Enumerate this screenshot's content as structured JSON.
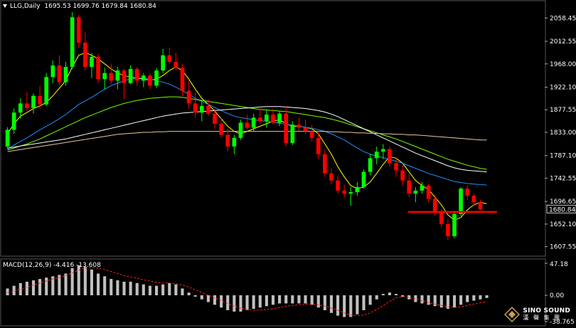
{
  "header": {
    "symbol": "LLG,Daily",
    "ohlc": "1695.53 1699.76 1679.84 1680.84"
  },
  "macd_header": "MACD(12,26,9) -4.416 -13.608",
  "last_price_label": "1680.84",
  "colors": {
    "background": "#000000",
    "bull": "#00ff00",
    "bear": "#ff0000",
    "fast_ma": "#ffff00",
    "blue_ma": "#1e90ff",
    "green_ma": "#7cfc00",
    "white_ma": "#ffffff",
    "tan_ma": "#e6c89a",
    "macd_hist": "#c0c0c0",
    "macd_signal": "#ff2020",
    "support": "#ff0000",
    "grid": "#333333"
  },
  "logo": {
    "line1": "SINO SOUND",
    "line2": "漢 聲 集 團",
    "icon": "diamond-logo-icon"
  },
  "chart_data": [
    {
      "type": "candlestick",
      "ylim": [
        1600,
        2080
      ],
      "yticks": [
        2058.45,
        2012.55,
        1968.0,
        1922.1,
        1877.55,
        1833.0,
        1787.1,
        1742.55,
        1696.65,
        1652.1,
        1607.55
      ],
      "support_level": 1676,
      "candles": [
        [
          1805,
          1843,
          1801,
          1838
        ],
        [
          1838,
          1880,
          1830,
          1872
        ],
        [
          1872,
          1900,
          1860,
          1890
        ],
        [
          1890,
          1912,
          1875,
          1881
        ],
        [
          1881,
          1910,
          1870,
          1905
        ],
        [
          1905,
          1925,
          1880,
          1888
        ],
        [
          1888,
          1950,
          1885,
          1942
        ],
        [
          1942,
          1975,
          1930,
          1965
        ],
        [
          1965,
          1985,
          1925,
          1932
        ],
        [
          1932,
          1972,
          1925,
          1962
        ],
        [
          1962,
          2070,
          1958,
          2060
        ],
        [
          2060,
          2065,
          2000,
          2010
        ],
        [
          2010,
          2030,
          1955,
          1962
        ],
        [
          1962,
          1990,
          1940,
          1982
        ],
        [
          1982,
          1988,
          1930,
          1938
        ],
        [
          1938,
          1960,
          1918,
          1950
        ],
        [
          1950,
          1968,
          1928,
          1935
        ],
        [
          1935,
          1962,
          1918,
          1955
        ],
        [
          1955,
          1958,
          1898,
          1930
        ],
        [
          1930,
          1965,
          1928,
          1958
        ],
        [
          1958,
          1962,
          1925,
          1935
        ],
        [
          1935,
          1950,
          1922,
          1945
        ],
        [
          1945,
          1950,
          1918,
          1925
        ],
        [
          1925,
          1960,
          1920,
          1955
        ],
        [
          1955,
          1998,
          1950,
          1985
        ],
        [
          1985,
          2000,
          1968,
          1972
        ],
        [
          1972,
          1990,
          1955,
          1960
        ],
        [
          1960,
          1968,
          1905,
          1915
        ],
        [
          1915,
          1935,
          1880,
          1890
        ],
        [
          1890,
          1912,
          1862,
          1872
        ],
        [
          1872,
          1895,
          1855,
          1885
        ],
        [
          1885,
          1898,
          1865,
          1870
        ],
        [
          1870,
          1880,
          1840,
          1850
        ],
        [
          1850,
          1862,
          1822,
          1828
        ],
        [
          1828,
          1840,
          1795,
          1805
        ],
        [
          1805,
          1828,
          1790,
          1822
        ],
        [
          1822,
          1858,
          1818,
          1852
        ],
        [
          1852,
          1868,
          1838,
          1842
        ],
        [
          1842,
          1870,
          1835,
          1862
        ],
        [
          1862,
          1880,
          1850,
          1855
        ],
        [
          1855,
          1878,
          1842,
          1868
        ],
        [
          1868,
          1880,
          1848,
          1852
        ],
        [
          1852,
          1875,
          1845,
          1870
        ],
        [
          1870,
          1885,
          1805,
          1812
        ],
        [
          1812,
          1855,
          1808,
          1848
        ],
        [
          1848,
          1862,
          1835,
          1842
        ],
        [
          1842,
          1858,
          1830,
          1835
        ],
        [
          1835,
          1848,
          1815,
          1822
        ],
        [
          1822,
          1835,
          1780,
          1790
        ],
        [
          1790,
          1800,
          1745,
          1752
        ],
        [
          1752,
          1762,
          1730,
          1738
        ],
        [
          1738,
          1748,
          1712,
          1718
        ],
        [
          1718,
          1730,
          1705,
          1712
        ],
        [
          1712,
          1725,
          1688,
          1715
        ],
        [
          1715,
          1735,
          1708,
          1725
        ],
        [
          1725,
          1760,
          1722,
          1755
        ],
        [
          1755,
          1790,
          1748,
          1782
        ],
        [
          1782,
          1805,
          1770,
          1795
        ],
        [
          1795,
          1810,
          1780,
          1800
        ],
        [
          1800,
          1805,
          1765,
          1772
        ],
        [
          1772,
          1782,
          1745,
          1758
        ],
        [
          1758,
          1768,
          1728,
          1738
        ],
        [
          1738,
          1750,
          1705,
          1712
        ],
        [
          1712,
          1725,
          1695,
          1718
        ],
        [
          1718,
          1735,
          1712,
          1728
        ],
        [
          1728,
          1732,
          1695,
          1702
        ],
        [
          1702,
          1710,
          1668,
          1675
        ],
        [
          1675,
          1682,
          1645,
          1652
        ],
        [
          1652,
          1662,
          1620,
          1628
        ],
        [
          1628,
          1678,
          1624,
          1672
        ],
        [
          1672,
          1725,
          1668,
          1722
        ],
        [
          1722,
          1728,
          1700,
          1708
        ],
        [
          1708,
          1712,
          1688,
          1695
        ],
        [
          1695,
          1700,
          1679,
          1681
        ]
      ],
      "series": [
        {
          "key": "fast_ma",
          "values": [
            1830,
            1850,
            1865,
            1872,
            1880,
            1885,
            1892,
            1905,
            1920,
            1935,
            1962,
            1985,
            1990,
            1985,
            1978,
            1968,
            1958,
            1950,
            1945,
            1942,
            1940,
            1938,
            1936,
            1938,
            1945,
            1955,
            1962,
            1955,
            1938,
            1918,
            1900,
            1888,
            1875,
            1860,
            1845,
            1835,
            1830,
            1835,
            1840,
            1845,
            1850,
            1855,
            1858,
            1850,
            1845,
            1845,
            1843,
            1840,
            1830,
            1810,
            1790,
            1765,
            1745,
            1728,
            1722,
            1725,
            1735,
            1752,
            1770,
            1785,
            1782,
            1772,
            1755,
            1738,
            1728,
            1720,
            1705,
            1690,
            1670,
            1660,
            1665,
            1680,
            1690,
            1695,
            1692
          ]
        },
        {
          "key": "blue_ma",
          "values": [
            1800,
            1808,
            1815,
            1822,
            1830,
            1838,
            1845,
            1852,
            1860,
            1868,
            1878,
            1888,
            1895,
            1902,
            1910,
            1918,
            1925,
            1930,
            1935,
            1938,
            1940,
            1940,
            1938,
            1935,
            1932,
            1928,
            1922,
            1915,
            1908,
            1900,
            1894,
            1888,
            1882,
            1876,
            1870,
            1865,
            1862,
            1860,
            1858,
            1856,
            1855,
            1853,
            1851,
            1849,
            1847,
            1845,
            1843,
            1841,
            1838,
            1835,
            1830,
            1824,
            1818,
            1810,
            1802,
            1795,
            1790,
            1786,
            1783,
            1780,
            1776,
            1772,
            1767,
            1762,
            1757,
            1752,
            1748,
            1744,
            1740,
            1736,
            1734,
            1732,
            1731,
            1730,
            1729
          ]
        },
        {
          "key": "green_ma",
          "values": [
            1798,
            1802,
            1806,
            1810,
            1815,
            1820,
            1826,
            1832,
            1838,
            1844,
            1850,
            1856,
            1862,
            1867,
            1872,
            1877,
            1882,
            1886,
            1890,
            1893,
            1896,
            1898,
            1900,
            1901,
            1902,
            1903,
            1903,
            1902,
            1900,
            1898,
            1896,
            1894,
            1892,
            1890,
            1888,
            1886,
            1884,
            1882,
            1880,
            1878,
            1877,
            1876,
            1875,
            1874,
            1872,
            1870,
            1868,
            1866,
            1864,
            1862,
            1859,
            1856,
            1852,
            1848,
            1844,
            1840,
            1836,
            1832,
            1828,
            1824,
            1820,
            1815,
            1810,
            1805,
            1800,
            1795,
            1790,
            1785,
            1780,
            1776,
            1772,
            1768,
            1765,
            1762,
            1760
          ]
        },
        {
          "key": "white_ma",
          "values": [
            1802,
            1804,
            1806,
            1808,
            1810,
            1812,
            1814,
            1816,
            1818,
            1820,
            1823,
            1826,
            1829,
            1832,
            1835,
            1838,
            1841,
            1844,
            1847,
            1850,
            1853,
            1856,
            1859,
            1862,
            1865,
            1867,
            1869,
            1871,
            1872,
            1873,
            1874,
            1875,
            1876,
            1877,
            1878,
            1879,
            1880,
            1881,
            1882,
            1883,
            1884,
            1884,
            1884,
            1883,
            1882,
            1881,
            1880,
            1878,
            1876,
            1873,
            1869,
            1864,
            1858,
            1852,
            1846,
            1840,
            1834,
            1828,
            1822,
            1816,
            1810,
            1804,
            1798,
            1792,
            1787,
            1782,
            1777,
            1772,
            1767,
            1763,
            1760,
            1758,
            1757,
            1756,
            1755
          ]
        },
        {
          "key": "tan_ma",
          "values": [
            1795,
            1797,
            1799,
            1801,
            1803,
            1805,
            1807,
            1809,
            1811,
            1813,
            1815,
            1817,
            1819,
            1821,
            1823,
            1825,
            1827,
            1829,
            1830,
            1831,
            1832,
            1833,
            1833,
            1834,
            1834,
            1835,
            1835,
            1835,
            1835,
            1835,
            1835,
            1835,
            1835,
            1835,
            1835,
            1835,
            1835,
            1835,
            1835,
            1835,
            1835,
            1835,
            1835,
            1835,
            1835,
            1835,
            1835,
            1835,
            1835,
            1835,
            1834,
            1834,
            1833,
            1833,
            1832,
            1832,
            1831,
            1831,
            1830,
            1830,
            1829,
            1829,
            1828,
            1828,
            1827,
            1826,
            1825,
            1824,
            1823,
            1822,
            1821,
            1820,
            1819,
            1818,
            1818
          ]
        }
      ]
    },
    {
      "type": "macd",
      "ylim": [
        -38.765,
        47.18
      ],
      "yticks": [
        47.18,
        0.0,
        -38.765
      ],
      "hist": [
        10,
        14,
        18,
        20,
        22,
        24,
        26,
        28,
        30,
        32,
        40,
        44,
        42,
        38,
        32,
        28,
        24,
        22,
        20,
        20,
        18,
        16,
        14,
        14,
        16,
        18,
        16,
        10,
        4,
        -2,
        -6,
        -10,
        -14,
        -18,
        -22,
        -24,
        -24,
        -22,
        -20,
        -18,
        -16,
        -14,
        -12,
        -12,
        -12,
        -12,
        -12,
        -14,
        -18,
        -22,
        -26,
        -30,
        -32,
        -32,
        -28,
        -22,
        -14,
        -6,
        2,
        4,
        2,
        -2,
        -6,
        -10,
        -12,
        -14,
        -16,
        -18,
        -20,
        -18,
        -14,
        -10,
        -8,
        -6,
        -4
      ],
      "signal": [
        4,
        6,
        9,
        12,
        15,
        18,
        21,
        24,
        26,
        29,
        33,
        37,
        40,
        41,
        40,
        38,
        35,
        32,
        29,
        27,
        25,
        23,
        21,
        19,
        18,
        18,
        17,
        15,
        12,
        8,
        4,
        0,
        -4,
        -8,
        -12,
        -16,
        -19,
        -21,
        -22,
        -22,
        -21,
        -20,
        -18,
        -16,
        -15,
        -14,
        -13,
        -13,
        -14,
        -16,
        -19,
        -22,
        -26,
        -29,
        -30,
        -29,
        -26,
        -21,
        -15,
        -9,
        -4,
        -2,
        -3,
        -5,
        -8,
        -11,
        -13,
        -15,
        -17,
        -18,
        -17,
        -15,
        -13,
        -11,
        -9
      ]
    }
  ]
}
